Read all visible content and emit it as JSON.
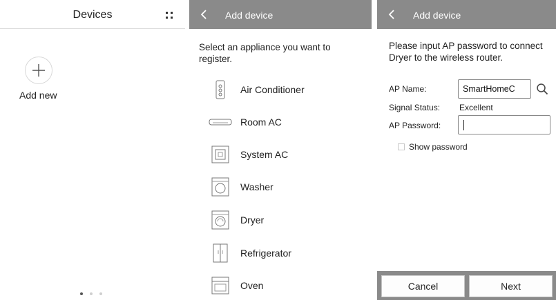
{
  "devices": {
    "title": "Devices",
    "add_new_label": "Add new",
    "icons": {
      "menu": "grid-menu-icon",
      "add": "plus-icon"
    },
    "page_dots": 3,
    "active_dot": 0
  },
  "add_device": {
    "header_title": "Add device",
    "intro": "Select an appliance you want to register.",
    "appliances": [
      {
        "label": "Air Conditioner",
        "icon": "air-conditioner-icon"
      },
      {
        "label": "Room AC",
        "icon": "room-ac-icon"
      },
      {
        "label": "System AC",
        "icon": "system-ac-icon"
      },
      {
        "label": "Washer",
        "icon": "washer-icon"
      },
      {
        "label": "Dryer",
        "icon": "dryer-icon"
      },
      {
        "label": "Refrigerator",
        "icon": "refrigerator-icon"
      },
      {
        "label": "Oven",
        "icon": "oven-icon"
      }
    ]
  },
  "ap_password": {
    "header_title": "Add device",
    "intro": "Please input AP password to connect Dryer to the wireless router.",
    "ap_name_label": "AP Name:",
    "ap_name_value": "SmartHomeC",
    "signal_label": "Signal Status:",
    "signal_value": "Excellent",
    "password_label": "AP Password:",
    "password_value": "",
    "show_password_label": "Show password",
    "cancel_label": "Cancel",
    "next_label": "Next"
  },
  "colors": {
    "header_bar": "#8a8a8a",
    "header_text": "#ffffff",
    "text": "#222222",
    "border": "#888888"
  }
}
